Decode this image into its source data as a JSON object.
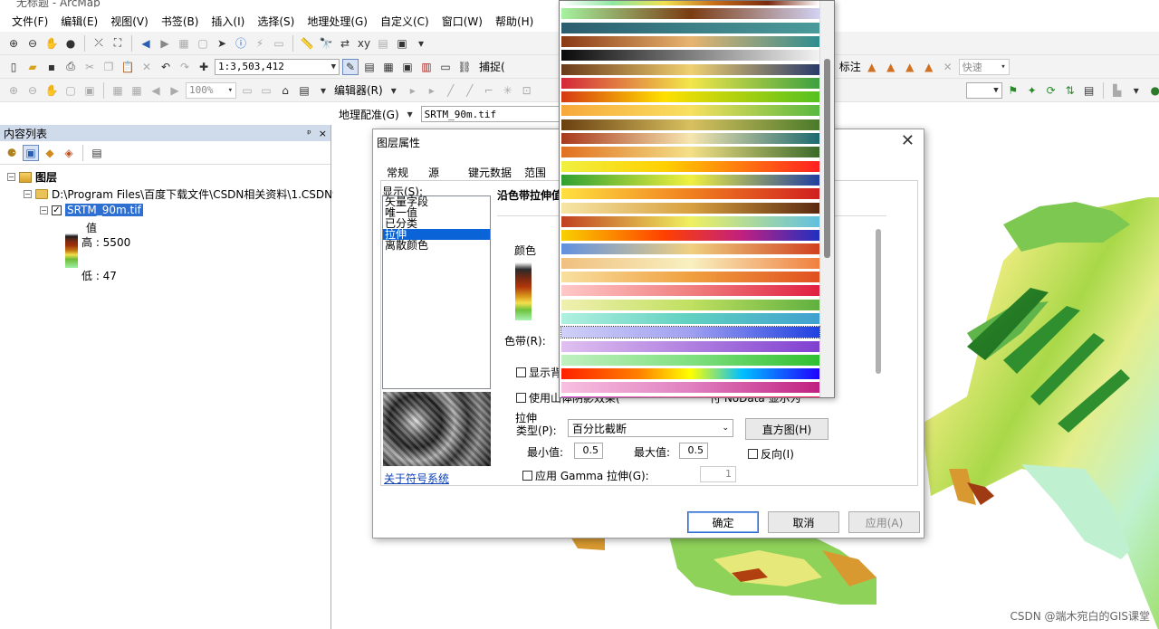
{
  "window": {
    "title": "无标题 - ArcMap"
  },
  "menu": [
    "文件(F)",
    "编辑(E)",
    "视图(V)",
    "书签(B)",
    "插入(I)",
    "选择(S)",
    "地理处理(G)",
    "自定义(C)",
    "窗口(W)",
    "帮助(H)"
  ],
  "toolbar": {
    "scale": "1:3,503,412",
    "zoom": "100%",
    "editor": "编辑器(R)",
    "capture": "捕捉(",
    "label_menu": "标注",
    "speed": "快速",
    "georef": "地理配准(G)",
    "georef_layer": "SRTM_90m.tif"
  },
  "toc": {
    "title": "内容列表",
    "pin": "ᵖ",
    "close": "×",
    "root": "图层",
    "folder": "D:\\Program Files\\百度下载文件\\CSDN相关资料\\1.CSDN制",
    "layer": "SRTM_90m.tif",
    "value_label": "值",
    "high": "高 : 5500",
    "low": "低 : 47"
  },
  "dialog": {
    "title": "图层属性",
    "close": "✕",
    "tabs": [
      "常规",
      "源",
      "键元数据",
      "范围"
    ],
    "show_label": "显示(S):",
    "renderers": [
      "矢量字段",
      "唯一值",
      "已分类",
      "拉伸",
      "离散颜色"
    ],
    "selected_renderer": "拉伸",
    "panel_title": "沿色带拉伸值",
    "color_label": "颜色",
    "band_label": "色带(R):",
    "show_bg": "显示背",
    "use_hillshade": "使用山体阴影效果(",
    "hillshade_suffix": "付 NoData 显示为",
    "stretch_label": "拉伸",
    "type_label": "类型(P):",
    "type_value": "百分比截断",
    "histogram_btn": "直方图(H)",
    "min_label": "最小值:",
    "min_value": "0.5",
    "max_label": "最大值:",
    "max_value": "0.5",
    "invert": "反向(I)",
    "gamma_label": "应用 Gamma 拉伸(G):",
    "gamma_value": "1",
    "about_link": "关于符号系统",
    "ok": "确定",
    "cancel": "取消",
    "apply": "应用(A)"
  },
  "colorRamps": [
    {
      "stops": "#ffffff,#8ee8a0 20%,#f1e050 40%,#c46b18 60%,#7a2a10 80%,#ffffff"
    },
    {
      "stops": "#a5f3a0,#7a3b12 50%,#d2d2f2"
    },
    {
      "stops": "#2b5d6e,#3c7f86 50%,#4b9a9a"
    },
    {
      "stops": "#8a3a14,#e7b470 50%,#2f8d8f"
    },
    {
      "stops": "#0a0a0a,#f2f2f2"
    },
    {
      "stops": "#6a3a1a,#f0d070 50%,#2a3a6a"
    },
    {
      "stops": "#d4283a,#f2e64a 50%,#3da040"
    },
    {
      "stops": "#d63a12,#ffe000 40%,#54c020"
    },
    {
      "stops": "#f7a83a,#f8e060 50%,#58b840"
    },
    {
      "stops": "#6a4010,#d8c060 50%,#4a7a2a"
    },
    {
      "stops": "#a8381c,#f6e6b0 50%,#1e6a70"
    },
    {
      "stops": "#e07020,#f4e088 50%,#3a6a2a"
    },
    {
      "stops": "#f0f040,#ffd000 40%,#ff2020"
    },
    {
      "stops": "#30a030,#f0f040 50%,#2040a0"
    },
    {
      "stops": "#ffe040,#f08020 50%,#d02020"
    },
    {
      "stops": "#f6e6a6,#d8a040 50%,#5a2a10"
    },
    {
      "stops": "#c04020,#f0f060 50%,#60c0e0"
    },
    {
      "stops": "#f8d000,#ff4000 40%,#c02080 70%,#2030c0"
    },
    {
      "stops": "#6090e0,#f0d080 50%,#d04020"
    },
    {
      "stops": "#f0c080,#f8f0c0 50%,#f08040"
    },
    {
      "stops": "#f8e0a0,#f0a040 50%,#e05020"
    },
    {
      "stops": "#ffc8c8,#f08080 50%,#e02040"
    },
    {
      "stops": "#f0f0b0,#c0e060 50%,#60b040"
    },
    {
      "stops": "#b0f0e0,#60d0c0 50%,#40a0d0"
    },
    {
      "stops": "#d0d0f8,#a0a0f0 50%,#2040e0"
    },
    {
      "stops": "#e0c0f0,#b080e0 50%,#8040d0"
    },
    {
      "stops": "#c0f0c0,#80e080 50%,#30c030"
    },
    {
      "stops": "#ff2000,#ff8000 30%,#ffff00 50%,#00c0ff 70%,#2000ff"
    },
    {
      "stops": "#f8c0e0,#e080c0 50%,#c02080"
    },
    {
      "stops": "#e040e0,#ff60a0 50%,#ff2060"
    },
    {
      "stops": "#20c0f0,#4080f0 50%,#2020e0"
    },
    {
      "stops": "#e0e060,#80d040 50%,#20a020"
    },
    {
      "stops": "#20a020,#80e020 50%,#f0f020"
    },
    {
      "stops": "#ff0000,#ffff00 25%,#00ff00 45%,#00ffff 60%,#0000ff 80%,#ff00ff"
    },
    {
      "stops": "#e06060,#c0e060 50%,#60a040"
    }
  ],
  "watermark": "CSDN @端木宛白的GIS课堂"
}
